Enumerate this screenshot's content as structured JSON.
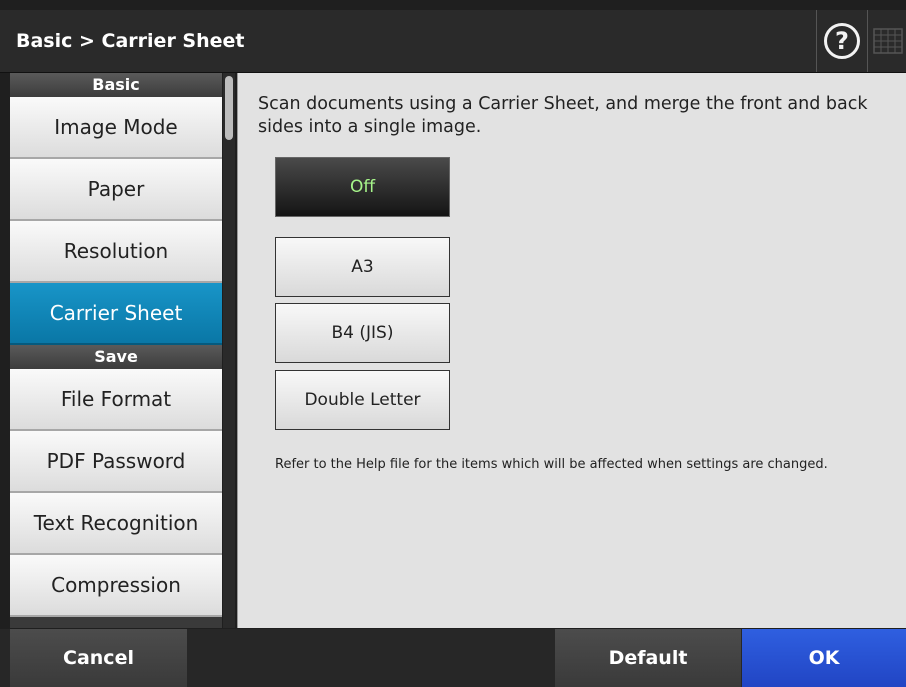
{
  "header": {
    "title": "Basic > Carrier Sheet",
    "help_icon": "help-circle-icon",
    "keyboard_icon": "keyboard-icon"
  },
  "sidebar": {
    "sections": [
      {
        "label": "Basic",
        "items": [
          {
            "label": "Image Mode"
          },
          {
            "label": "Paper"
          },
          {
            "label": "Resolution"
          },
          {
            "label": "Carrier Sheet",
            "selected": true
          }
        ]
      },
      {
        "label": "Save",
        "items": [
          {
            "label": "File Format"
          },
          {
            "label": "PDF Password"
          },
          {
            "label": "Text Recognition"
          },
          {
            "label": "Compression"
          }
        ]
      }
    ]
  },
  "main": {
    "description": "Scan documents using a Carrier Sheet, and merge the front and back sides into a single image.",
    "options": [
      {
        "label": "Off",
        "selected": true
      },
      {
        "label": "A3"
      },
      {
        "label": "B4 (JIS)"
      },
      {
        "label": "Double Letter"
      }
    ],
    "note": "Refer to the Help file for the items which will be affected when settings are changed."
  },
  "footer": {
    "cancel_label": "Cancel",
    "default_label": "Default",
    "ok_label": "OK"
  },
  "colors": {
    "accent_selected_nav": "#0f86b8",
    "ok_button": "#2a52d6",
    "selected_option_text": "#a6f58a"
  }
}
